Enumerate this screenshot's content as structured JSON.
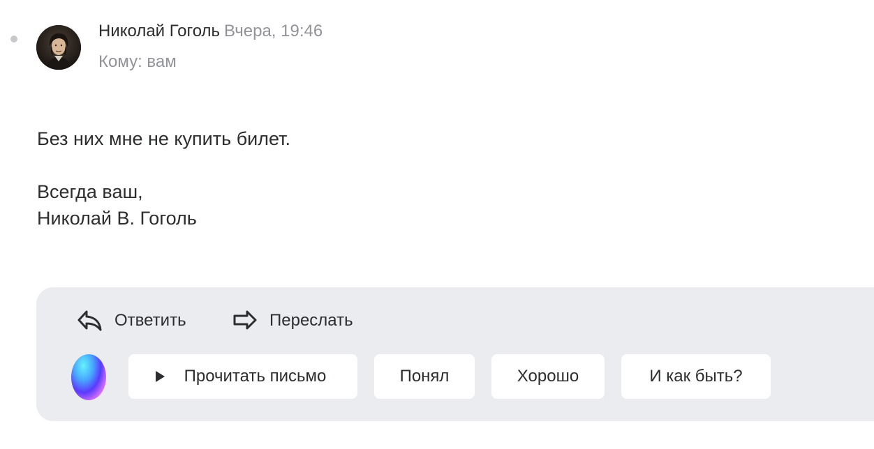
{
  "message": {
    "sender_name": "Николай Гоголь",
    "date": "Вчера, 19:46",
    "recipient": "Кому: вам",
    "body_line1": "Без них мне не купить билет.",
    "body_line2": "Всегда ваш,",
    "body_line3": "Николай В. Гоголь"
  },
  "actions": {
    "reply_label": "Ответить",
    "forward_label": "Переслать"
  },
  "quick_replies": {
    "read_aloud_label": "Прочитать письмо",
    "replies": [
      "Понял",
      "Хорошо",
      "И как быть?"
    ]
  },
  "icons": {
    "unread": "unread-dot-icon",
    "reply": "reply-arrow-icon",
    "forward": "forward-arrow-icon",
    "play": "play-icon",
    "assistant": "voice-assistant-icon"
  },
  "colors": {
    "text": "#2c2d2e",
    "secondary_text": "#919399",
    "panel_background": "#ebecef",
    "chip_background": "#ffffff",
    "unread_dot": "#c7c9cc"
  }
}
